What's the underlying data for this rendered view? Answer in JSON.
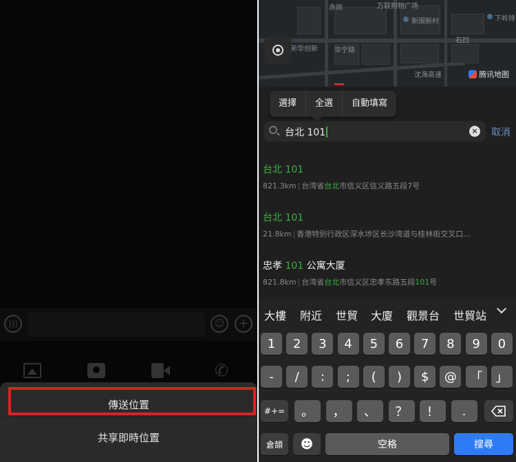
{
  "left": {
    "sheet": {
      "send_location": "傳送位置",
      "share_live_location": "共享即時位置"
    }
  },
  "map": {
    "labels": [
      "新华创新",
      "华宁路",
      "新围新村",
      "石凹",
      "沈海高速",
      "万联购物广场",
      "下岭排",
      "赤岗"
    ],
    "brand": "腾讯地图"
  },
  "context_menu": {
    "items": [
      "選擇",
      "全選",
      "自動填寫"
    ]
  },
  "search": {
    "value": "台北 101",
    "cancel": "取消"
  },
  "results": [
    {
      "title_parts": [
        {
          "t": "台北 101",
          "hl": true
        }
      ],
      "distance": "821.3km",
      "address_parts": [
        {
          "t": "台湾省",
          "hl": false
        },
        {
          "t": "台北",
          "hl": true
        },
        {
          "t": "市信义区信义路五段7号",
          "hl": false
        }
      ]
    },
    {
      "title_parts": [
        {
          "t": "台北 101",
          "hl": true
        }
      ],
      "distance": "21.8km",
      "address_parts": [
        {
          "t": "香港特别行政区深水埗区长沙湾道与桂林街交叉口...",
          "hl": false
        }
      ]
    },
    {
      "title_parts": [
        {
          "t": "忠孝 ",
          "hl": false
        },
        {
          "t": "101",
          "hl": true
        },
        {
          "t": " 公寓大厦",
          "hl": false
        }
      ],
      "distance": "821.8km",
      "address_parts": [
        {
          "t": "台湾省",
          "hl": false
        },
        {
          "t": "台北",
          "hl": true
        },
        {
          "t": "市信义区忠孝东路五段",
          "hl": false
        },
        {
          "t": "101",
          "hl": true
        },
        {
          "t": "号",
          "hl": false
        }
      ]
    }
  ],
  "keyboard": {
    "candidates": [
      "大樓",
      "附近",
      "世貿",
      "大廈",
      "觀景台",
      "世貿站"
    ],
    "row1": [
      "1",
      "2",
      "3",
      "4",
      "5",
      "6",
      "7",
      "8",
      "9",
      "0"
    ],
    "row2": [
      "-",
      "/",
      ":",
      ";",
      "(",
      ")",
      "$",
      "@",
      "「",
      "」"
    ],
    "row3_mode": "#+=",
    "row3": [
      "。",
      "，",
      "、",
      "？",
      "！",
      "."
    ],
    "bottom": {
      "switch": "倉頡",
      "space": "空格",
      "go": "搜尋"
    }
  },
  "colors": {
    "highlight_green": "#3cb043",
    "accent_blue": "#2f7bf5",
    "annotation_red": "#e02020"
  }
}
